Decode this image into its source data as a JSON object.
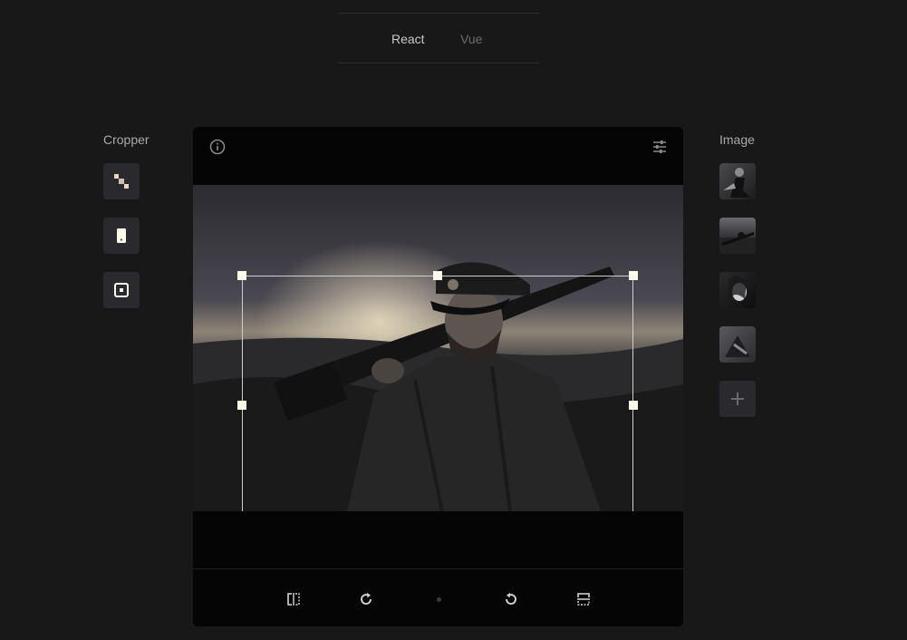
{
  "tabs": [
    {
      "label": "React",
      "active": true
    },
    {
      "label": "Vue",
      "active": false
    }
  ],
  "left_panel": {
    "title": "Cropper",
    "buttons": [
      {
        "name": "free-crop",
        "icon": "diagonal-crop-icon"
      },
      {
        "name": "portrait-crop",
        "icon": "phone-portrait-icon"
      },
      {
        "name": "square-crop",
        "icon": "square-target-icon"
      }
    ]
  },
  "right_panel": {
    "title": "Image",
    "thumbnails": [
      {
        "name": "thumbnail-1"
      },
      {
        "name": "thumbnail-2"
      },
      {
        "name": "thumbnail-3"
      },
      {
        "name": "thumbnail-4"
      }
    ],
    "add_icon": "plus-icon"
  },
  "editor": {
    "top_icons": [
      "info-icon",
      "sliders-icon"
    ],
    "toolbar": [
      "flip-horizontal-icon",
      "rotate-right-icon",
      "rotate-left-icon",
      "flip-vertical-icon"
    ]
  },
  "colors": {
    "background": "#181819",
    "panel": "#050506",
    "button": "#2a2a2e",
    "handle": "#fffbea"
  }
}
